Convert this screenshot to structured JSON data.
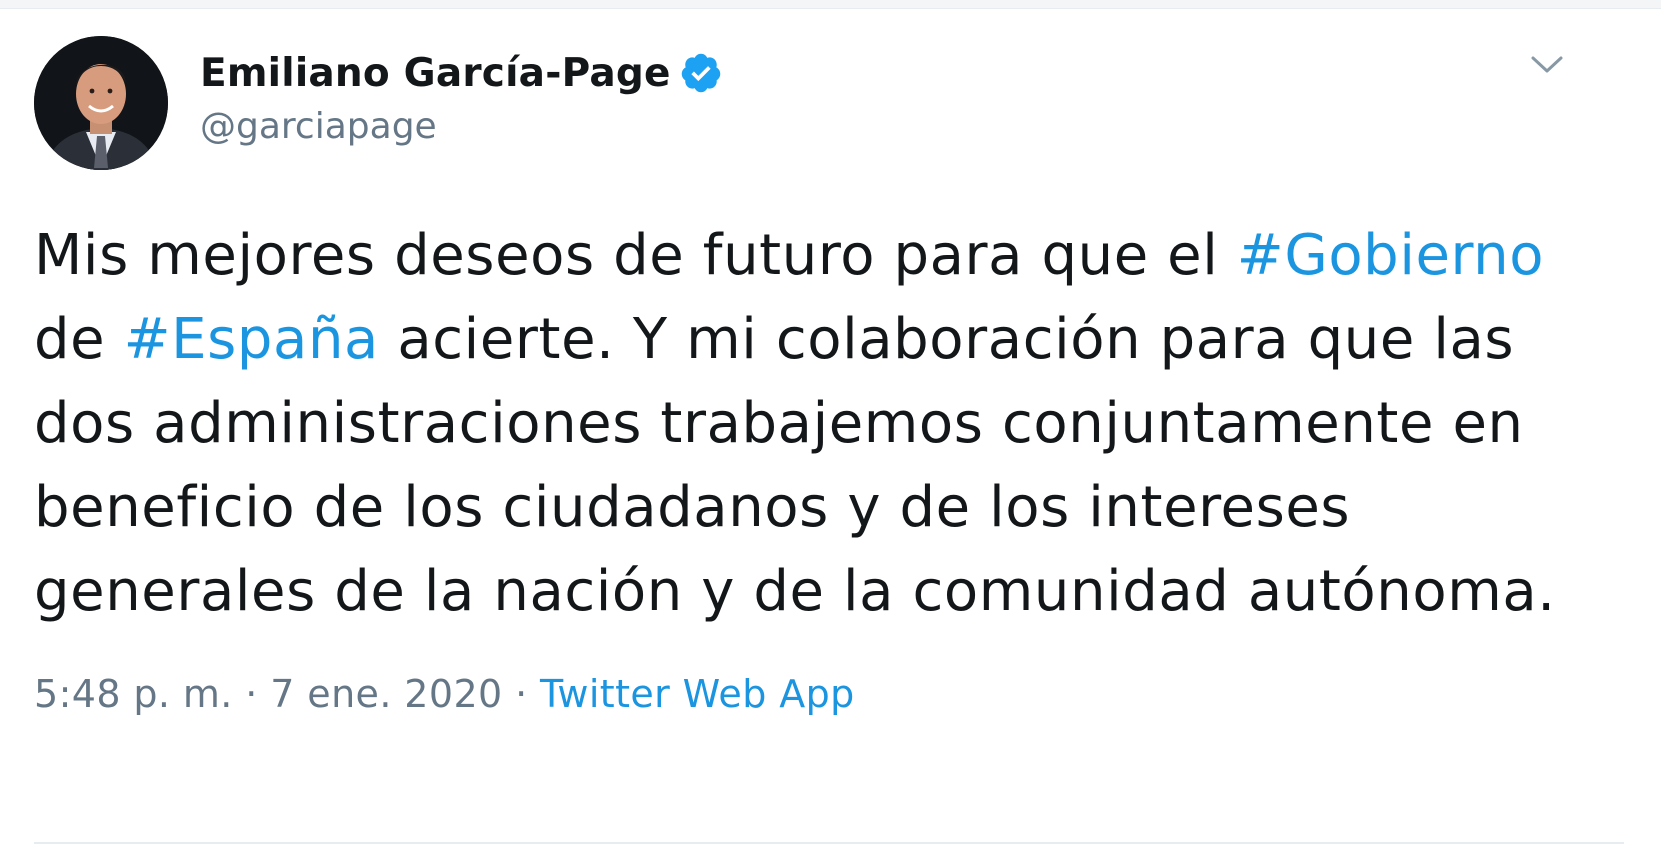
{
  "author": {
    "display_name": "Emiliano García-Page",
    "handle": "@garciapage",
    "verified": true
  },
  "tweet": {
    "text_part_1": "Mis mejores deseos de futuro para que el ",
    "hashtag_1": "#Gobierno",
    "text_part_2": " de ",
    "hashtag_2": "#España",
    "text_part_3": " acierte. Y mi colaboración para que las dos administraciones trabajemos conjuntamente en beneficio de los ciudadanos y de los intereses generales de la nación y de la comunidad autónoma."
  },
  "meta": {
    "time": "5:48 p. m.",
    "separator": " · ",
    "date": "7 ene. 2020",
    "source": "Twitter Web App"
  },
  "icons": {
    "verified": "verified-badge-icon",
    "menu": "chevron-down-icon"
  },
  "colors": {
    "accent": "#1b95e0",
    "secondary_text": "#657786",
    "primary_text": "#14171a"
  }
}
